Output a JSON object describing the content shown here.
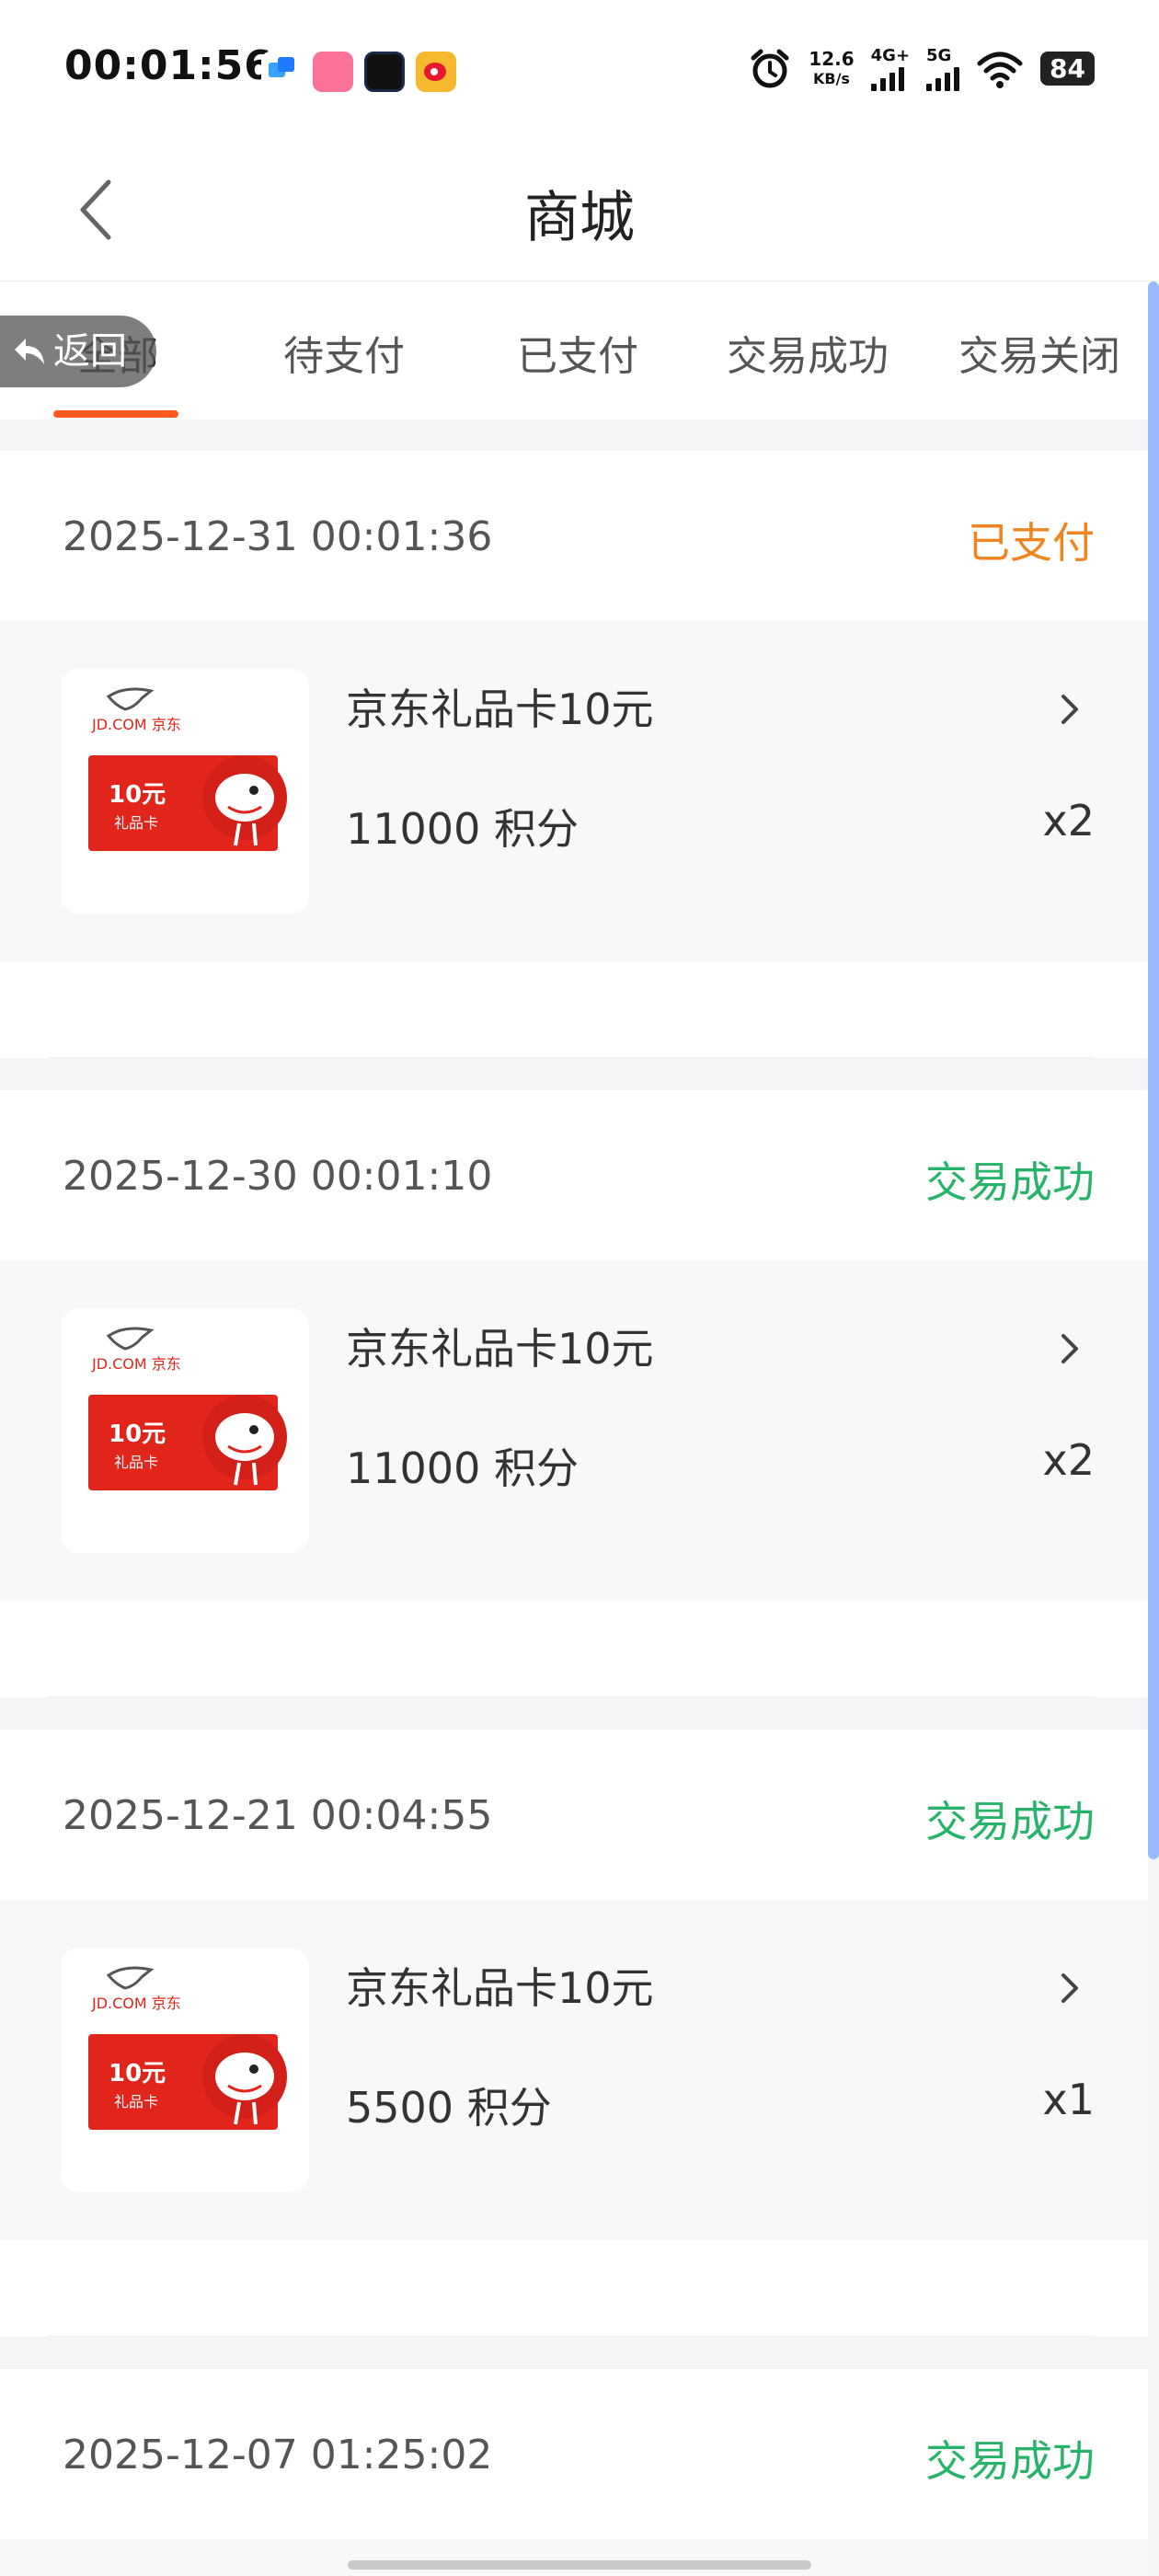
{
  "status_bar": {
    "time": "00:01:56",
    "net_speed_value": "12.6",
    "net_speed_unit": "KB/s",
    "signal_1": "4G+",
    "signal_2": "5G",
    "battery": "84"
  },
  "header": {
    "title": "商城"
  },
  "overlay": {
    "return_label": "返回"
  },
  "tabs": [
    {
      "label": "全部"
    },
    {
      "label": "待支付"
    },
    {
      "label": "已支付"
    },
    {
      "label": "交易成功"
    },
    {
      "label": "交易关闭"
    }
  ],
  "orders": [
    {
      "date": "2025-12-31 00:01:36",
      "status": "已支付",
      "status_color": "#f0851f",
      "item": {
        "name": "京东礼品卡10元",
        "price": "11000 积分",
        "qty": "x2",
        "card_brand": "JD.COM 京东",
        "card_value": "10元",
        "card_sub": "礼品卡"
      }
    },
    {
      "date": "2025-12-30 00:01:10",
      "status": "交易成功",
      "status_color": "#27b36a",
      "item": {
        "name": "京东礼品卡10元",
        "price": "11000 积分",
        "qty": "x2",
        "card_brand": "JD.COM 京东",
        "card_value": "10元",
        "card_sub": "礼品卡"
      }
    },
    {
      "date": "2025-12-21 00:04:55",
      "status": "交易成功",
      "status_color": "#27b36a",
      "item": {
        "name": "京东礼品卡10元",
        "price": "5500 积分",
        "qty": "x1",
        "card_brand": "JD.COM 京东",
        "card_value": "10元",
        "card_sub": "礼品卡"
      }
    },
    {
      "date": "2025-12-07 01:25:02",
      "status": "交易成功",
      "status_color": "#27b36a"
    }
  ]
}
